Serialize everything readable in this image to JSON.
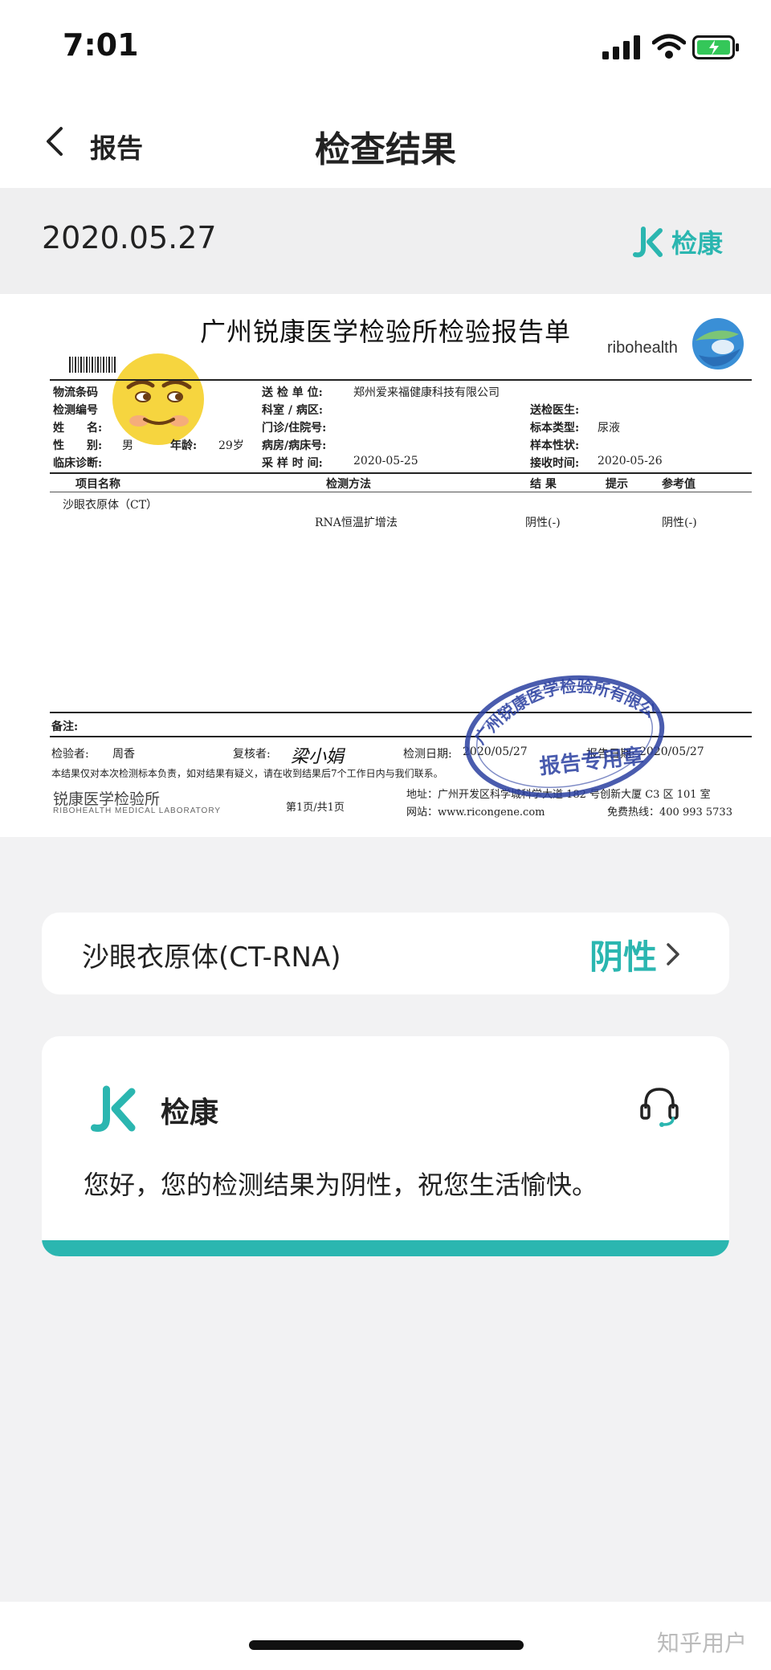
{
  "status": {
    "time": "7:01"
  },
  "nav": {
    "back_label": "报告",
    "title": "检查结果"
  },
  "report_header": {
    "date": "2020.05.27",
    "brand": "检康"
  },
  "report_image": {
    "title": "广州锐康医学检验所检验报告单",
    "logo_text": "ribohealth",
    "labels": {
      "logistics_code": "物流条码",
      "test_no": "检测编号",
      "name": "姓　　名:",
      "gender": "性　　别:",
      "gender_value": "男",
      "age": "年龄:",
      "age_value": "29岁",
      "diagnosis": "临床诊断:",
      "sender": "送 检 单 位:",
      "sender_value": "郑州爱来福健康科技有限公司",
      "dept": "科室 / 病区:",
      "outpatient": "门诊/住院号:",
      "ward": "病房/病床号:",
      "sample_time": "采 样 时 间:",
      "sample_time_value": "2020-05-25",
      "doctor": "送检医生:",
      "sample_type": "标本类型:",
      "sample_type_value": "尿液",
      "sample_state": "样本性状:",
      "receive_time": "接收时间:",
      "receive_time_value": "2020-05-26"
    },
    "table": {
      "headers": [
        "项目名称",
        "检测方法",
        "结 果",
        "提示",
        "参考值"
      ],
      "row": [
        "沙眼衣原体（CT）",
        "RNA恒温扩增法",
        "阴性(-)",
        "",
        "阴性(-)"
      ]
    },
    "footer": {
      "remark": "备注:",
      "tester_label": "检验者:",
      "tester": "周香",
      "reviewer_label": "复核者:",
      "reviewer_sign": "梁小娟",
      "test_date_label": "检测日期:",
      "test_date": "2020/05/27",
      "report_date_label": "报告日期:",
      "report_date": "2020/05/27",
      "disclaimer": "本结果仅对本次检测标本负责，如对结果有疑义，请在收到结果后7个工作日内与我们联系。",
      "page": "第1页/共1页",
      "address": "地址：广州开发区科学城科学大道 182 号创新大厦 C3 区 101 室",
      "website": "网站：www.ricongene.com",
      "hotline": "免费热线：400 993 5733",
      "brand_cn": "锐康医学检验所",
      "brand_en": "RIBOHEALTH MEDICAL LABORATORY",
      "stamp_text": "广州锐康医学检验所有限公司",
      "stamp_sub": "报告专用章"
    }
  },
  "result_card": {
    "name": "沙眼衣原体(CT-RNA)",
    "result": "阴性"
  },
  "message_card": {
    "brand": "检康",
    "message": "您好，您的检测结果为阴性，祝您生活愉快。"
  },
  "watermark": "知乎用户",
  "colors": {
    "accent": "#2bb6b0",
    "stamp": "#2a3fa0"
  }
}
